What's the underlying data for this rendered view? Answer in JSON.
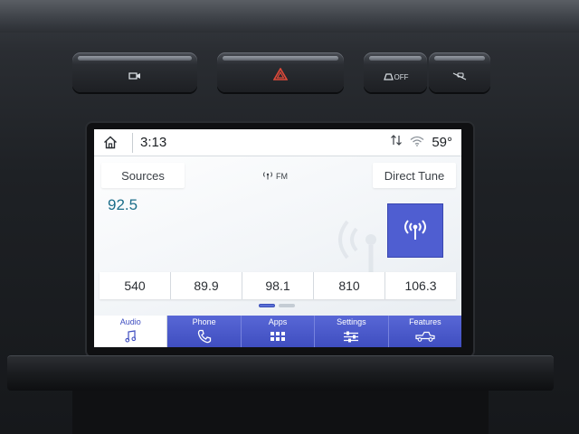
{
  "hardware": {
    "buttons": [
      {
        "name": "camera-button",
        "icon": "camera-icon",
        "label": ""
      },
      {
        "name": "hazard-button",
        "icon": "hazard-triangle-icon",
        "label": ""
      },
      {
        "name": "traction-off-button",
        "icon": "traction-control-off-icon",
        "label": "OFF"
      },
      {
        "name": "hill-descent-button",
        "icon": "hill-descent-icon",
        "label": ""
      }
    ],
    "hazard_color": "#e04a3a"
  },
  "status_bar": {
    "time": "3:13",
    "temperature": "59°",
    "icons": [
      "home-icon",
      "data-arrows-icon",
      "wifi-icon"
    ]
  },
  "audio": {
    "sources_label": "Sources",
    "band_label": "FM",
    "direct_tune_label": "Direct Tune",
    "current_frequency": "92.5",
    "presets": [
      "540",
      "89.9",
      "98.1",
      "810",
      "106.3"
    ],
    "pager": {
      "page": 1,
      "pages": 2
    }
  },
  "nav": {
    "items": [
      {
        "label": "Audio",
        "icon": "music-note-icon",
        "active": true
      },
      {
        "label": "Phone",
        "icon": "phone-icon",
        "active": false
      },
      {
        "label": "Apps",
        "icon": "apps-grid-icon",
        "active": false
      },
      {
        "label": "Settings",
        "icon": "sliders-icon",
        "active": false
      },
      {
        "label": "Features",
        "icon": "truck-icon",
        "active": false
      }
    ]
  },
  "colors": {
    "accent": "#4f5ed1",
    "nav_background": "#4a59cc",
    "frequency_text": "#1c6e8a"
  }
}
